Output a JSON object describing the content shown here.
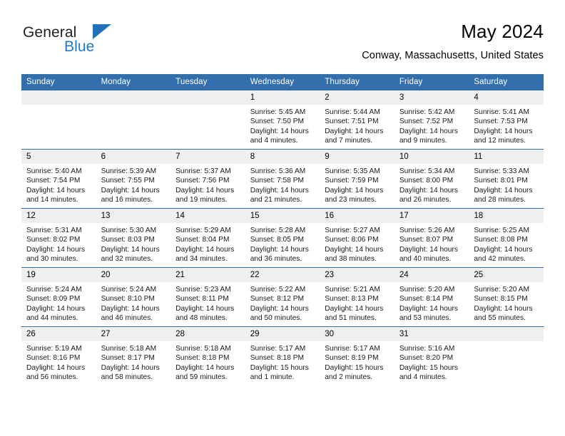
{
  "brand": {
    "name_top": "General",
    "name_bottom": "Blue",
    "flag_color": "#2172b8",
    "text_color": "#231f20"
  },
  "header": {
    "title": "May 2024",
    "location": "Conway, Massachusetts, United States"
  },
  "theme": {
    "header_bg": "#336fac",
    "header_text": "#ffffff",
    "daynum_bg": "#efefef",
    "row_border": "#336fac"
  },
  "weekday_headers": [
    "Sunday",
    "Monday",
    "Tuesday",
    "Wednesday",
    "Thursday",
    "Friday",
    "Saturday"
  ],
  "weeks": [
    [
      {
        "blank": true
      },
      {
        "blank": true
      },
      {
        "blank": true
      },
      {
        "day": "1",
        "sunrise": "Sunrise: 5:45 AM",
        "sunset": "Sunset: 7:50 PM",
        "daylight": "Daylight: 14 hours and 4 minutes."
      },
      {
        "day": "2",
        "sunrise": "Sunrise: 5:44 AM",
        "sunset": "Sunset: 7:51 PM",
        "daylight": "Daylight: 14 hours and 7 minutes."
      },
      {
        "day": "3",
        "sunrise": "Sunrise: 5:42 AM",
        "sunset": "Sunset: 7:52 PM",
        "daylight": "Daylight: 14 hours and 9 minutes."
      },
      {
        "day": "4",
        "sunrise": "Sunrise: 5:41 AM",
        "sunset": "Sunset: 7:53 PM",
        "daylight": "Daylight: 14 hours and 12 minutes."
      }
    ],
    [
      {
        "day": "5",
        "sunrise": "Sunrise: 5:40 AM",
        "sunset": "Sunset: 7:54 PM",
        "daylight": "Daylight: 14 hours and 14 minutes."
      },
      {
        "day": "6",
        "sunrise": "Sunrise: 5:39 AM",
        "sunset": "Sunset: 7:55 PM",
        "daylight": "Daylight: 14 hours and 16 minutes."
      },
      {
        "day": "7",
        "sunrise": "Sunrise: 5:37 AM",
        "sunset": "Sunset: 7:56 PM",
        "daylight": "Daylight: 14 hours and 19 minutes."
      },
      {
        "day": "8",
        "sunrise": "Sunrise: 5:36 AM",
        "sunset": "Sunset: 7:58 PM",
        "daylight": "Daylight: 14 hours and 21 minutes."
      },
      {
        "day": "9",
        "sunrise": "Sunrise: 5:35 AM",
        "sunset": "Sunset: 7:59 PM",
        "daylight": "Daylight: 14 hours and 23 minutes."
      },
      {
        "day": "10",
        "sunrise": "Sunrise: 5:34 AM",
        "sunset": "Sunset: 8:00 PM",
        "daylight": "Daylight: 14 hours and 26 minutes."
      },
      {
        "day": "11",
        "sunrise": "Sunrise: 5:33 AM",
        "sunset": "Sunset: 8:01 PM",
        "daylight": "Daylight: 14 hours and 28 minutes."
      }
    ],
    [
      {
        "day": "12",
        "sunrise": "Sunrise: 5:31 AM",
        "sunset": "Sunset: 8:02 PM",
        "daylight": "Daylight: 14 hours and 30 minutes."
      },
      {
        "day": "13",
        "sunrise": "Sunrise: 5:30 AM",
        "sunset": "Sunset: 8:03 PM",
        "daylight": "Daylight: 14 hours and 32 minutes."
      },
      {
        "day": "14",
        "sunrise": "Sunrise: 5:29 AM",
        "sunset": "Sunset: 8:04 PM",
        "daylight": "Daylight: 14 hours and 34 minutes."
      },
      {
        "day": "15",
        "sunrise": "Sunrise: 5:28 AM",
        "sunset": "Sunset: 8:05 PM",
        "daylight": "Daylight: 14 hours and 36 minutes."
      },
      {
        "day": "16",
        "sunrise": "Sunrise: 5:27 AM",
        "sunset": "Sunset: 8:06 PM",
        "daylight": "Daylight: 14 hours and 38 minutes."
      },
      {
        "day": "17",
        "sunrise": "Sunrise: 5:26 AM",
        "sunset": "Sunset: 8:07 PM",
        "daylight": "Daylight: 14 hours and 40 minutes."
      },
      {
        "day": "18",
        "sunrise": "Sunrise: 5:25 AM",
        "sunset": "Sunset: 8:08 PM",
        "daylight": "Daylight: 14 hours and 42 minutes."
      }
    ],
    [
      {
        "day": "19",
        "sunrise": "Sunrise: 5:24 AM",
        "sunset": "Sunset: 8:09 PM",
        "daylight": "Daylight: 14 hours and 44 minutes."
      },
      {
        "day": "20",
        "sunrise": "Sunrise: 5:24 AM",
        "sunset": "Sunset: 8:10 PM",
        "daylight": "Daylight: 14 hours and 46 minutes."
      },
      {
        "day": "21",
        "sunrise": "Sunrise: 5:23 AM",
        "sunset": "Sunset: 8:11 PM",
        "daylight": "Daylight: 14 hours and 48 minutes."
      },
      {
        "day": "22",
        "sunrise": "Sunrise: 5:22 AM",
        "sunset": "Sunset: 8:12 PM",
        "daylight": "Daylight: 14 hours and 50 minutes."
      },
      {
        "day": "23",
        "sunrise": "Sunrise: 5:21 AM",
        "sunset": "Sunset: 8:13 PM",
        "daylight": "Daylight: 14 hours and 51 minutes."
      },
      {
        "day": "24",
        "sunrise": "Sunrise: 5:20 AM",
        "sunset": "Sunset: 8:14 PM",
        "daylight": "Daylight: 14 hours and 53 minutes."
      },
      {
        "day": "25",
        "sunrise": "Sunrise: 5:20 AM",
        "sunset": "Sunset: 8:15 PM",
        "daylight": "Daylight: 14 hours and 55 minutes."
      }
    ],
    [
      {
        "day": "26",
        "sunrise": "Sunrise: 5:19 AM",
        "sunset": "Sunset: 8:16 PM",
        "daylight": "Daylight: 14 hours and 56 minutes."
      },
      {
        "day": "27",
        "sunrise": "Sunrise: 5:18 AM",
        "sunset": "Sunset: 8:17 PM",
        "daylight": "Daylight: 14 hours and 58 minutes."
      },
      {
        "day": "28",
        "sunrise": "Sunrise: 5:18 AM",
        "sunset": "Sunset: 8:18 PM",
        "daylight": "Daylight: 14 hours and 59 minutes."
      },
      {
        "day": "29",
        "sunrise": "Sunrise: 5:17 AM",
        "sunset": "Sunset: 8:18 PM",
        "daylight": "Daylight: 15 hours and 1 minute."
      },
      {
        "day": "30",
        "sunrise": "Sunrise: 5:17 AM",
        "sunset": "Sunset: 8:19 PM",
        "daylight": "Daylight: 15 hours and 2 minutes."
      },
      {
        "day": "31",
        "sunrise": "Sunrise: 5:16 AM",
        "sunset": "Sunset: 8:20 PM",
        "daylight": "Daylight: 15 hours and 4 minutes."
      },
      {
        "blank": true
      }
    ]
  ]
}
